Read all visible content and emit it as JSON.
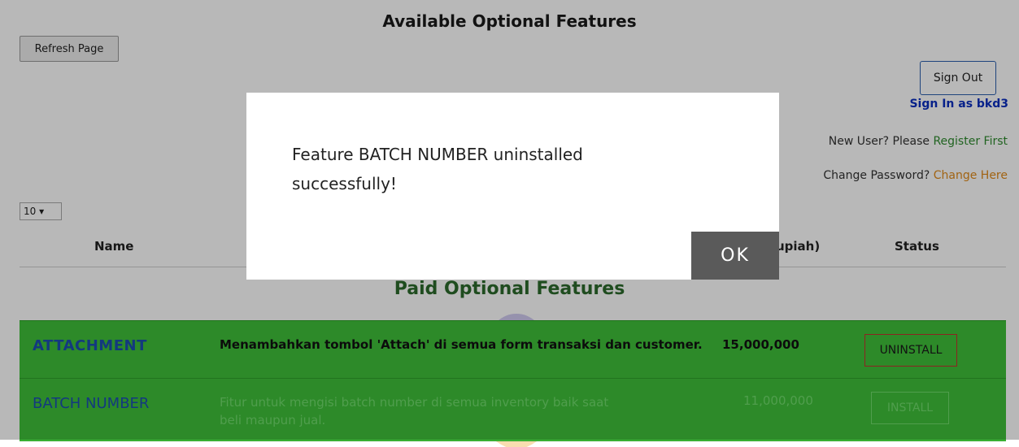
{
  "header": {
    "title": "Available Optional Features",
    "refresh_label": "Refresh Page"
  },
  "account": {
    "signout_label": "Sign Out",
    "signed_in_text": "Sign In as bkd3",
    "new_user_prompt": "New User? Please ",
    "register_link": "Register First",
    "change_pw_prompt": "Change Password? ",
    "change_pw_link": "Change Here"
  },
  "table": {
    "page_size": "10 ▾",
    "columns": {
      "name": "Name",
      "price": "upiah)",
      "status": "Status"
    },
    "section_title": "Paid Optional Features",
    "rows": [
      {
        "name": "ATTACHMENT",
        "description": "Menambahkan tombol 'Attach' di semua form transaksi dan customer.",
        "price": "15,000,000",
        "action": "UNINSTALL"
      },
      {
        "name": "BATCH NUMBER",
        "description": "Fitur untuk mengisi batch number di semua inventory baik saat beli maupun jual.",
        "price": "11,000,000",
        "action": "INSTALL"
      }
    ]
  },
  "dialog": {
    "message": "Feature BATCH NUMBER uninstalled successfully!",
    "ok_label": "OK"
  },
  "colors": {
    "row_green": "#3fbf3a",
    "link_blue": "#1b4fb0",
    "signin_blue": "#0b2fbf",
    "register_green": "#2e8b2e",
    "change_orange": "#e08a1a",
    "ok_gray": "#5a5a5a"
  }
}
